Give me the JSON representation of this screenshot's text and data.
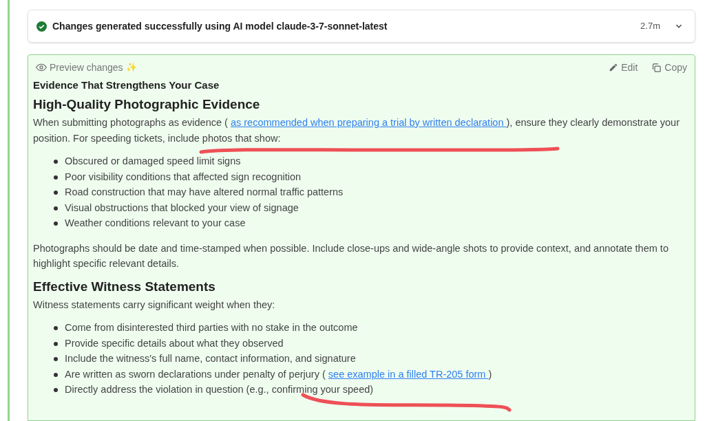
{
  "status": {
    "text": "Changes generated successfully using AI model",
    "model": "claude-3-7-sonnet-latest",
    "time": "2.7m"
  },
  "preview": {
    "label": "Preview changes",
    "sparkle": "✨",
    "actions": [
      {
        "kind": "edit",
        "label": "Edit"
      },
      {
        "kind": "copy",
        "label": "Copy"
      }
    ]
  },
  "content": [
    {
      "kind": "title",
      "text": "Evidence That Strengthens Your Case"
    },
    {
      "kind": "heading",
      "text": "High-Quality Photographic Evidence"
    },
    {
      "kind": "paragraph",
      "parts": [
        {
          "text": "When submitting photographs as evidence ( "
        },
        {
          "text": "as recommended when preparing a trial by written declaration ",
          "link": true
        },
        {
          "text": "), ensure they clearly demonstrate your position. For speeding tickets, include photos that show:"
        }
      ]
    },
    {
      "kind": "list",
      "items": [
        {
          "parts": [
            {
              "text": "Obscured or damaged speed limit signs"
            }
          ]
        },
        {
          "parts": [
            {
              "text": "Poor visibility conditions that affected sign recognition"
            }
          ]
        },
        {
          "parts": [
            {
              "text": "Road construction that may have altered normal traffic patterns"
            }
          ]
        },
        {
          "parts": [
            {
              "text": "Visual obstructions that blocked your view of signage"
            }
          ]
        },
        {
          "parts": [
            {
              "text": "Weather conditions relevant to your case"
            }
          ]
        }
      ]
    },
    {
      "kind": "paragraph",
      "parts": [
        {
          "text": "Photographs should be date and time-stamped when possible. Include close-ups and wide-angle shots to provide context, and annotate them to highlight specific relevant details."
        }
      ]
    },
    {
      "kind": "heading",
      "text": "Effective Witness Statements"
    },
    {
      "kind": "paragraph",
      "parts": [
        {
          "text": "Witness statements carry significant weight when they:"
        }
      ]
    },
    {
      "kind": "list",
      "items": [
        {
          "parts": [
            {
              "text": "Come from disinterested third parties with no stake in the outcome"
            }
          ]
        },
        {
          "parts": [
            {
              "text": "Provide specific details about what they observed"
            }
          ]
        },
        {
          "parts": [
            {
              "text": "Include the witness's full name, contact information, and signature"
            }
          ]
        },
        {
          "parts": [
            {
              "text": "Are written as sworn declarations under penalty of perjury ( "
            },
            {
              "text": "see example in a filled TR-205 form ",
              "link": true
            },
            {
              "text": ")"
            }
          ]
        },
        {
          "parts": [
            {
              "text": "Directly address the violation in question (e.g., confirming your speed)"
            }
          ]
        }
      ]
    }
  ]
}
